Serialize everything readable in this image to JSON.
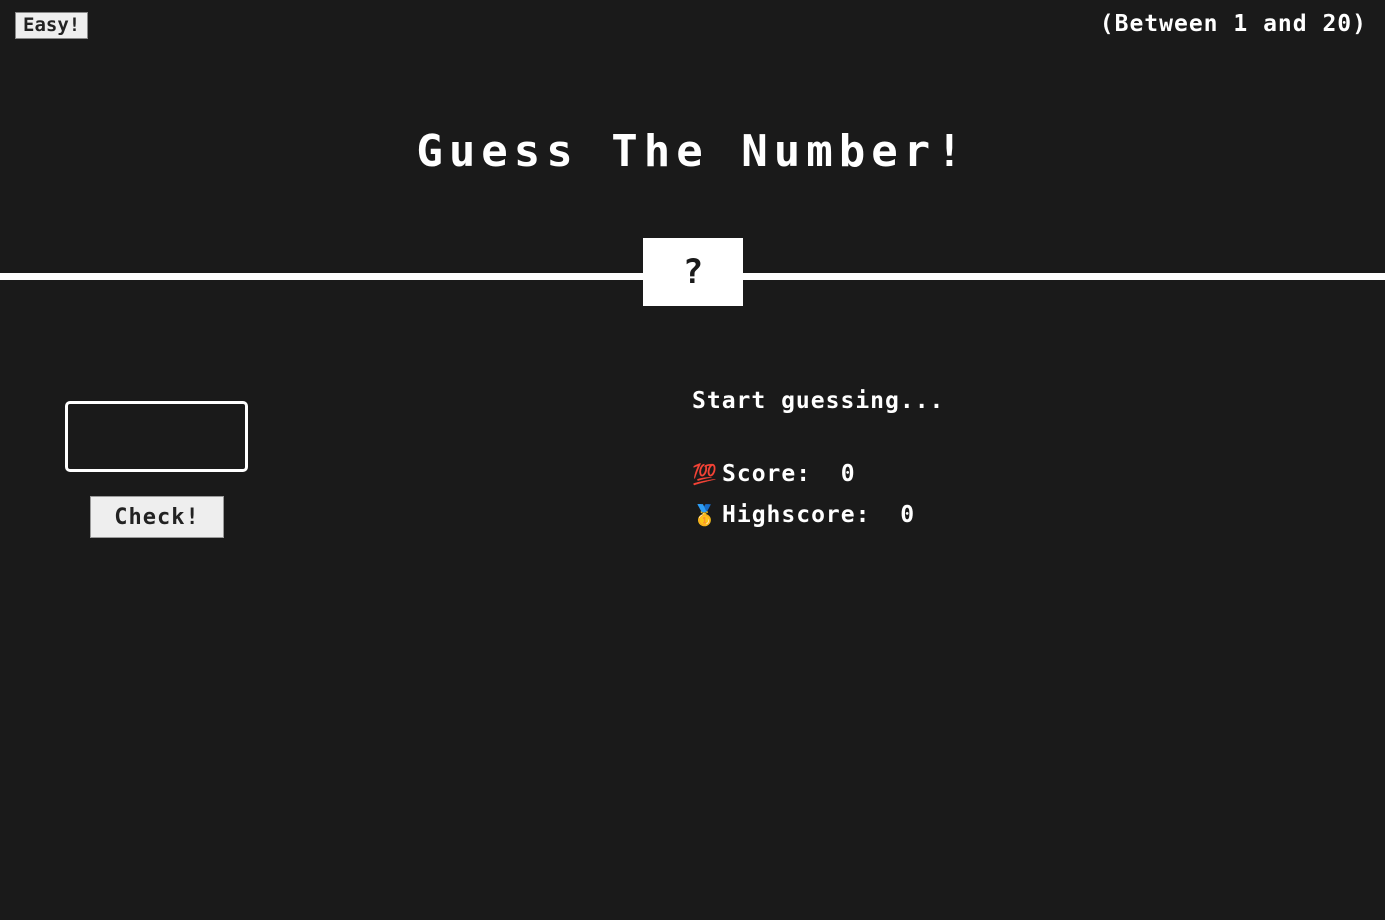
{
  "topbar": {
    "difficulty_label": "Easy!",
    "range_label": "(Between 1 and 20)"
  },
  "header": {
    "title": "Guess The Number!",
    "secret_number": "?"
  },
  "game": {
    "guess_value": "",
    "guess_placeholder": "",
    "check_label": "Check!",
    "message": "Start guessing...",
    "score_emoji": "💯",
    "score_label": "Score:",
    "score_value": "0",
    "highscore_emoji": "🥇",
    "highscore_label": "Highscore:",
    "highscore_value": "0"
  },
  "colors": {
    "background": "#1a1a1a",
    "foreground": "#ffffff",
    "accent": "#eeeeee"
  }
}
